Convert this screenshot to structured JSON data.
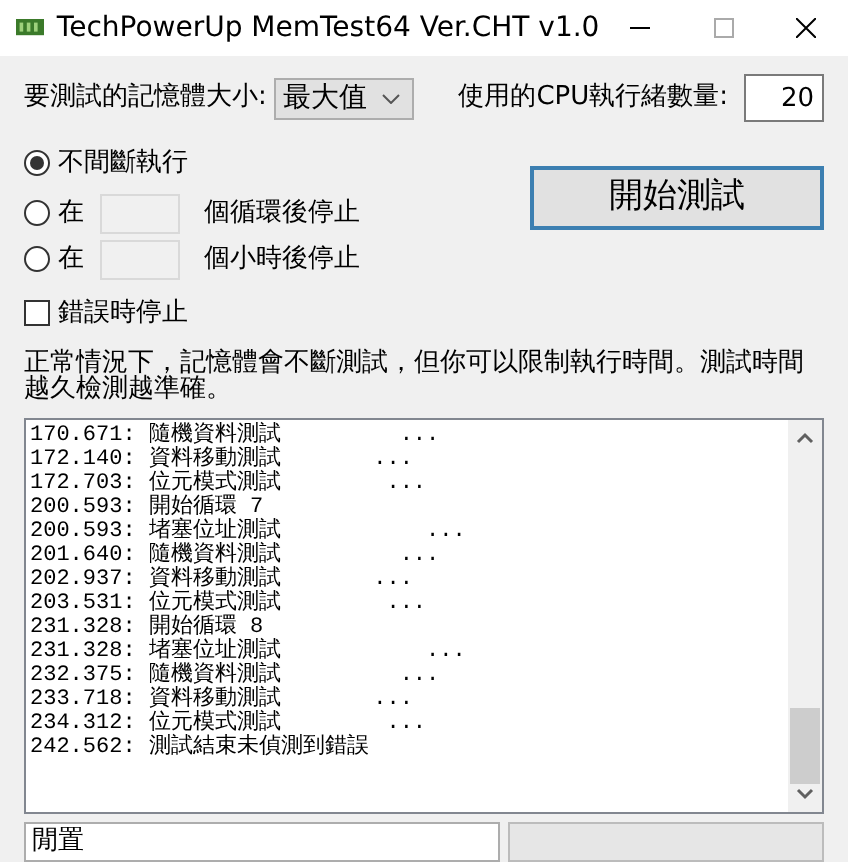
{
  "window": {
    "title": "TechPowerUp MemTest64 Ver.CHT v1.0"
  },
  "memory_size": {
    "label": "要測試的記憶體大小:",
    "value": "最大值"
  },
  "threads": {
    "label": "使用的CPU執行緒數量:",
    "value": "20"
  },
  "run_modes": [
    {
      "kind": "plain",
      "label": "不間斷執行",
      "selected": true
    },
    {
      "kind": "field",
      "prefix": "在",
      "suffix": "個循環後停止",
      "selected": false
    },
    {
      "kind": "field",
      "prefix": "在",
      "suffix": "個小時後停止",
      "selected": false
    }
  ],
  "start_button": "開始測試",
  "stop_on_error": {
    "label": "錯誤時停止",
    "checked": false
  },
  "note": "正常情況下，記憶體會不斷測試，但你可以限制執行時間。測試時間越久檢測越準確。",
  "log": [
    "170.671: 隨機資料測試         ...",
    "172.140: 資料移動測試       ...",
    "172.703: 位元模式測試        ...",
    "200.593: 開始循環 7",
    "200.593: 堵塞位址測試           ...",
    "201.640: 隨機資料測試         ...",
    "202.937: 資料移動測試       ...",
    "203.531: 位元模式測試        ...",
    "231.328: 開始循環 8",
    "231.328: 堵塞位址測試           ...",
    "232.375: 隨機資料測試         ...",
    "233.718: 資料移動測試       ...",
    "234.312: 位元模式測試        ...",
    "242.562: 測試結束未偵測到錯誤"
  ],
  "status_bar": {
    "text": "閒置"
  }
}
